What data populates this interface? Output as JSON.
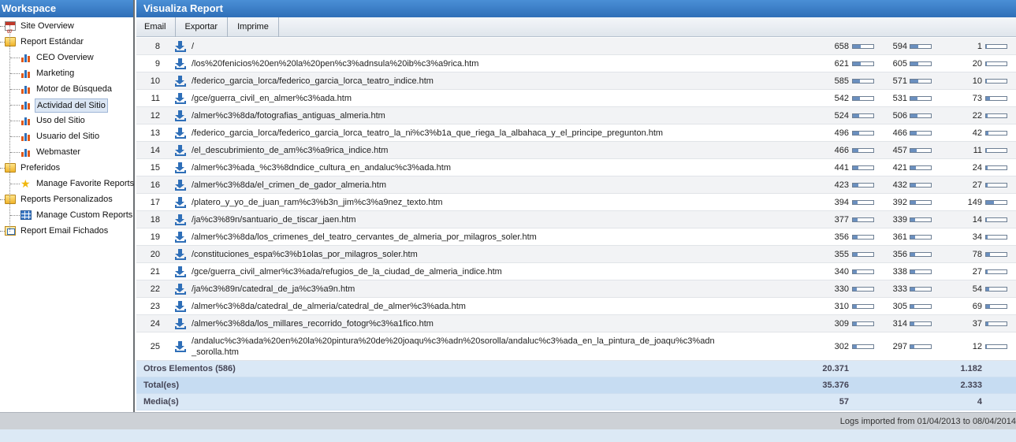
{
  "workspace": {
    "title": "Workspace",
    "items": [
      {
        "label": "Site Overview",
        "icon": "calendar-icon",
        "level": 0
      },
      {
        "label": "Report Estándar",
        "icon": "folder-icon",
        "level": 0
      },
      {
        "label": "CEO Overview",
        "icon": "bar-chart-icon",
        "level": 1
      },
      {
        "label": "Marketing",
        "icon": "bar-chart-icon",
        "level": 1
      },
      {
        "label": "Motor de Búsqueda",
        "icon": "bar-chart-icon",
        "level": 1
      },
      {
        "label": "Actividad del Sitio",
        "icon": "bar-chart-icon",
        "level": 1,
        "selected": true
      },
      {
        "label": "Uso del Sitio",
        "icon": "bar-chart-icon",
        "level": 1
      },
      {
        "label": "Usuario del Sitio",
        "icon": "bar-chart-icon",
        "level": 1
      },
      {
        "label": "Webmaster",
        "icon": "bar-chart-icon",
        "level": 1
      },
      {
        "label": "Preferidos",
        "icon": "folder-icon",
        "level": 0
      },
      {
        "label": "Manage Favorite Reports",
        "icon": "star-icon",
        "level": 1
      },
      {
        "label": "Reports Personalizados",
        "icon": "folder-icon",
        "level": 0
      },
      {
        "label": "Manage Custom Reports",
        "icon": "grid-icon",
        "level": 1
      },
      {
        "label": "Report Email Fichados",
        "icon": "mail-icon",
        "level": 0
      }
    ]
  },
  "main": {
    "title": "Visualiza Report",
    "toolbar": {
      "email": "Email",
      "export": "Exportar",
      "print": "Imprime"
    },
    "rows": [
      {
        "rank": "8",
        "path": "/",
        "v1": "658",
        "f1": 0.4,
        "v2": "594",
        "f2": 0.4,
        "v3": "1",
        "f3": 0.01
      },
      {
        "rank": "9",
        "path": "/los%20fenicios%20en%20la%20pen%c3%adnsula%20ib%c3%a9rica.htm",
        "v1": "621",
        "f1": 0.38,
        "v2": "605",
        "f2": 0.4,
        "v3": "20",
        "f3": 0.05
      },
      {
        "rank": "10",
        "path": "/federico_garcia_lorca/federico_garcia_lorca_teatro_indice.htm",
        "v1": "585",
        "f1": 0.36,
        "v2": "571",
        "f2": 0.38,
        "v3": "10",
        "f3": 0.03
      },
      {
        "rank": "11",
        "path": "/gce/guerra_civil_en_almer%c3%ada.htm",
        "v1": "542",
        "f1": 0.33,
        "v2": "531",
        "f2": 0.35,
        "v3": "73",
        "f3": 0.18
      },
      {
        "rank": "12",
        "path": "/almer%c3%8da/fotografias_antiguas_almeria.htm",
        "v1": "524",
        "f1": 0.32,
        "v2": "506",
        "f2": 0.33,
        "v3": "22",
        "f3": 0.06
      },
      {
        "rank": "13",
        "path": "/federico_garcia_lorca/federico_garcia_lorca_teatro_la_ni%c3%b1a_que_riega_la_albahaca_y_el_principe_pregunton.htm",
        "v1": "496",
        "f1": 0.3,
        "v2": "466",
        "f2": 0.31,
        "v3": "42",
        "f3": 0.1
      },
      {
        "rank": "14",
        "path": "/el_descubrimiento_de_am%c3%a9rica_indice.htm",
        "v1": "466",
        "f1": 0.28,
        "v2": "457",
        "f2": 0.3,
        "v3": "11",
        "f3": 0.03
      },
      {
        "rank": "15",
        "path": "/almer%c3%ada_%c3%8dndice_cultura_en_andaluc%c3%ada.htm",
        "v1": "441",
        "f1": 0.27,
        "v2": "421",
        "f2": 0.28,
        "v3": "24",
        "f3": 0.06
      },
      {
        "rank": "16",
        "path": "/almer%c3%8da/el_crimen_de_gador_almeria.htm",
        "v1": "423",
        "f1": 0.26,
        "v2": "432",
        "f2": 0.28,
        "v3": "27",
        "f3": 0.07
      },
      {
        "rank": "17",
        "path": "/platero_y_yo_de_juan_ram%c3%b3n_jim%c3%a9nez_texto.htm",
        "v1": "394",
        "f1": 0.24,
        "v2": "392",
        "f2": 0.26,
        "v3": "149",
        "f3": 0.4
      },
      {
        "rank": "18",
        "path": "/ja%c3%89n/santuario_de_tiscar_jaen.htm",
        "v1": "377",
        "f1": 0.23,
        "v2": "339",
        "f2": 0.22,
        "v3": "14",
        "f3": 0.04
      },
      {
        "rank": "19",
        "path": "/almer%c3%8da/los_crimenes_del_teatro_cervantes_de_almeria_por_milagros_soler.htm",
        "v1": "356",
        "f1": 0.22,
        "v2": "361",
        "f2": 0.24,
        "v3": "34",
        "f3": 0.09
      },
      {
        "rank": "20",
        "path": "/constituciones_espa%c3%b1olas_por_milagros_soler.htm",
        "v1": "355",
        "f1": 0.22,
        "v2": "356",
        "f2": 0.23,
        "v3": "78",
        "f3": 0.2
      },
      {
        "rank": "21",
        "path": "/gce/guerra_civil_almer%c3%ada/refugios_de_la_ciudad_de_almeria_indice.htm",
        "v1": "340",
        "f1": 0.21,
        "v2": "338",
        "f2": 0.22,
        "v3": "27",
        "f3": 0.07
      },
      {
        "rank": "22",
        "path": "/ja%c3%89n/catedral_de_ja%c3%a9n.htm",
        "v1": "330",
        "f1": 0.2,
        "v2": "333",
        "f2": 0.22,
        "v3": "54",
        "f3": 0.14
      },
      {
        "rank": "23",
        "path": "/almer%c3%8da/catedral_de_almeria/catedral_de_almer%c3%ada.htm",
        "v1": "310",
        "f1": 0.19,
        "v2": "305",
        "f2": 0.2,
        "v3": "69",
        "f3": 0.18
      },
      {
        "rank": "24",
        "path": "/almer%c3%8da/los_millares_recorrido_fotogr%c3%a1fico.htm",
        "v1": "309",
        "f1": 0.19,
        "v2": "314",
        "f2": 0.21,
        "v3": "37",
        "f3": 0.1
      },
      {
        "rank": "25",
        "path": "/andaluc%c3%ada%20en%20la%20pintura%20de%20joaqu%c3%adn%20sorolla/andaluc%c3%ada_en_la_pintura_de_joaqu%c3%adn\n_sorolla.htm",
        "v1": "302",
        "f1": 0.18,
        "v2": "297",
        "f2": 0.19,
        "v3": "12",
        "f3": 0.03,
        "tall": true
      }
    ],
    "summary": [
      {
        "label": "Otros Elementos (586)",
        "v1": "20.371",
        "v3": "1.182"
      },
      {
        "label": "Total(es)",
        "v1": "35.376",
        "v3": "2.333"
      },
      {
        "label": "Media(s)",
        "v1": "57",
        "v3": "4"
      }
    ]
  },
  "footer": {
    "text": "Logs imported from 01/04/2013 to 08/04/2014"
  },
  "colors": {
    "header": "#2f6fb8",
    "bar_fill": "#6a8fbf",
    "summary": "#dae8f6"
  }
}
